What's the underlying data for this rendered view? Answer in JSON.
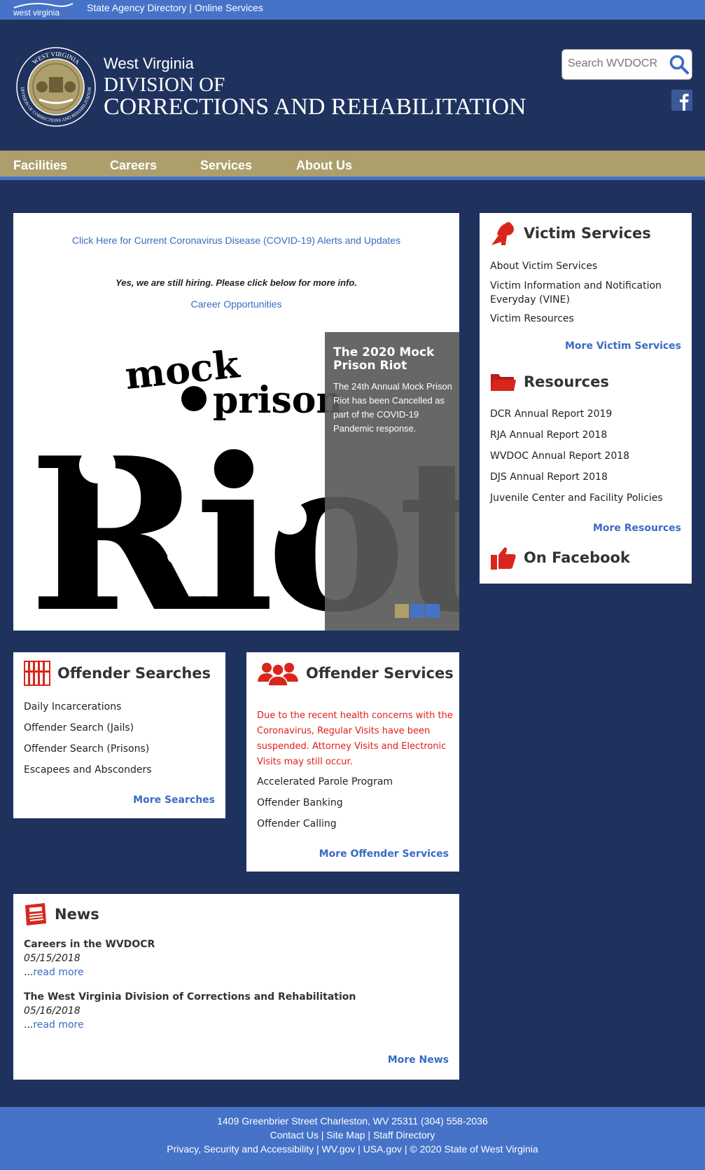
{
  "state_bar": {
    "logo_text": "west virginia",
    "agency_directory": "State Agency Directory",
    "separator": "|",
    "online_services": "Online Services"
  },
  "header": {
    "line1": "West Virginia",
    "line2": "DIVISION OF",
    "line3": "CORRECTIONS AND REHABILITATION",
    "seal_top_text": "WEST VIRGINIA",
    "seal_bottom_text": "DIVISION OF CORRECTIONS AND REHABILITATION",
    "search_placeholder": "Search WVDOCR"
  },
  "nav": {
    "items": [
      "Facilities",
      "Careers",
      "Services",
      "About Us"
    ]
  },
  "main": {
    "covid_link": "Click Here for Current Coronavirus Disease (COVID-19) Alerts and Updates",
    "hiring_text": "Yes, we are still hiring. Please click below for more info.",
    "career_link": "Career Opportunities",
    "slide": {
      "image_word1": "mock",
      "image_word2": "prison",
      "image_word3": "Riot",
      "title": "The 2020 Mock Prison Riot",
      "body": "The 24th Annual Mock Prison Riot has been Cancelled as part of the COVID-19 Pandemic response.",
      "dot_colors": [
        "#ad9f6c",
        "#4673c8",
        "#4673c8"
      ]
    }
  },
  "victim": {
    "title": "Victim Services",
    "items": [
      "About Victim Services",
      "Victim Information and Notification Everyday (VINE)",
      "Victim Resources"
    ],
    "more": "More Victim Services"
  },
  "resources": {
    "title": "Resources",
    "items": [
      "DCR Annual Report 2019",
      "RJA Annual Report 2018",
      "WVDOC Annual Report 2018",
      "DJS Annual Report 2018",
      "Juvenile Center and Facility Policies"
    ],
    "more": "More Resources"
  },
  "facebook": {
    "title": "On Facebook"
  },
  "searches": {
    "title": "Offender Searches",
    "items": [
      "Daily Incarcerations",
      "Offender Search (Jails)",
      "Offender Search (Prisons)",
      "Escapees and Absconders"
    ],
    "more": "More Searches"
  },
  "services": {
    "title": "Offender Services",
    "notice": "Due to the recent health concerns with the Coronavirus, Regular Visits have been suspended. Attorney Visits and Electronic Visits may still occur.",
    "items": [
      "Accelerated Parole Program",
      "Offender Banking",
      "Offender Calling"
    ],
    "more": "More Offender Services"
  },
  "news": {
    "title": "News",
    "items": [
      {
        "title": "Careers in the WVDOCR",
        "date": "05/15/2018",
        "ellipsis": "...",
        "more": "read more"
      },
      {
        "title": "The West Virginia Division of Corrections and Rehabilitation",
        "date": "05/16/2018",
        "ellipsis": "...",
        "more": "read more"
      }
    ],
    "more": "More News"
  },
  "footer": {
    "address": "1409 Greenbrier Street Charleston, WV 25311 (304) 558-2036",
    "contact": "Contact Us",
    "sitemap": "Site Map",
    "staff": "Staff Directory",
    "privacy": "Privacy, Security and Accessibility",
    "wvgov": "WV.gov",
    "usagov": "USA.gov",
    "copyright": "© 2020 State of West Virginia",
    "sep": "|"
  },
  "colors": {
    "navy": "#1f325e",
    "blue": "#4673c8",
    "gold": "#ad9f6c",
    "red_icon": "#d9261c",
    "link": "#3a6ac4",
    "notice_red": "#e31b1b"
  }
}
